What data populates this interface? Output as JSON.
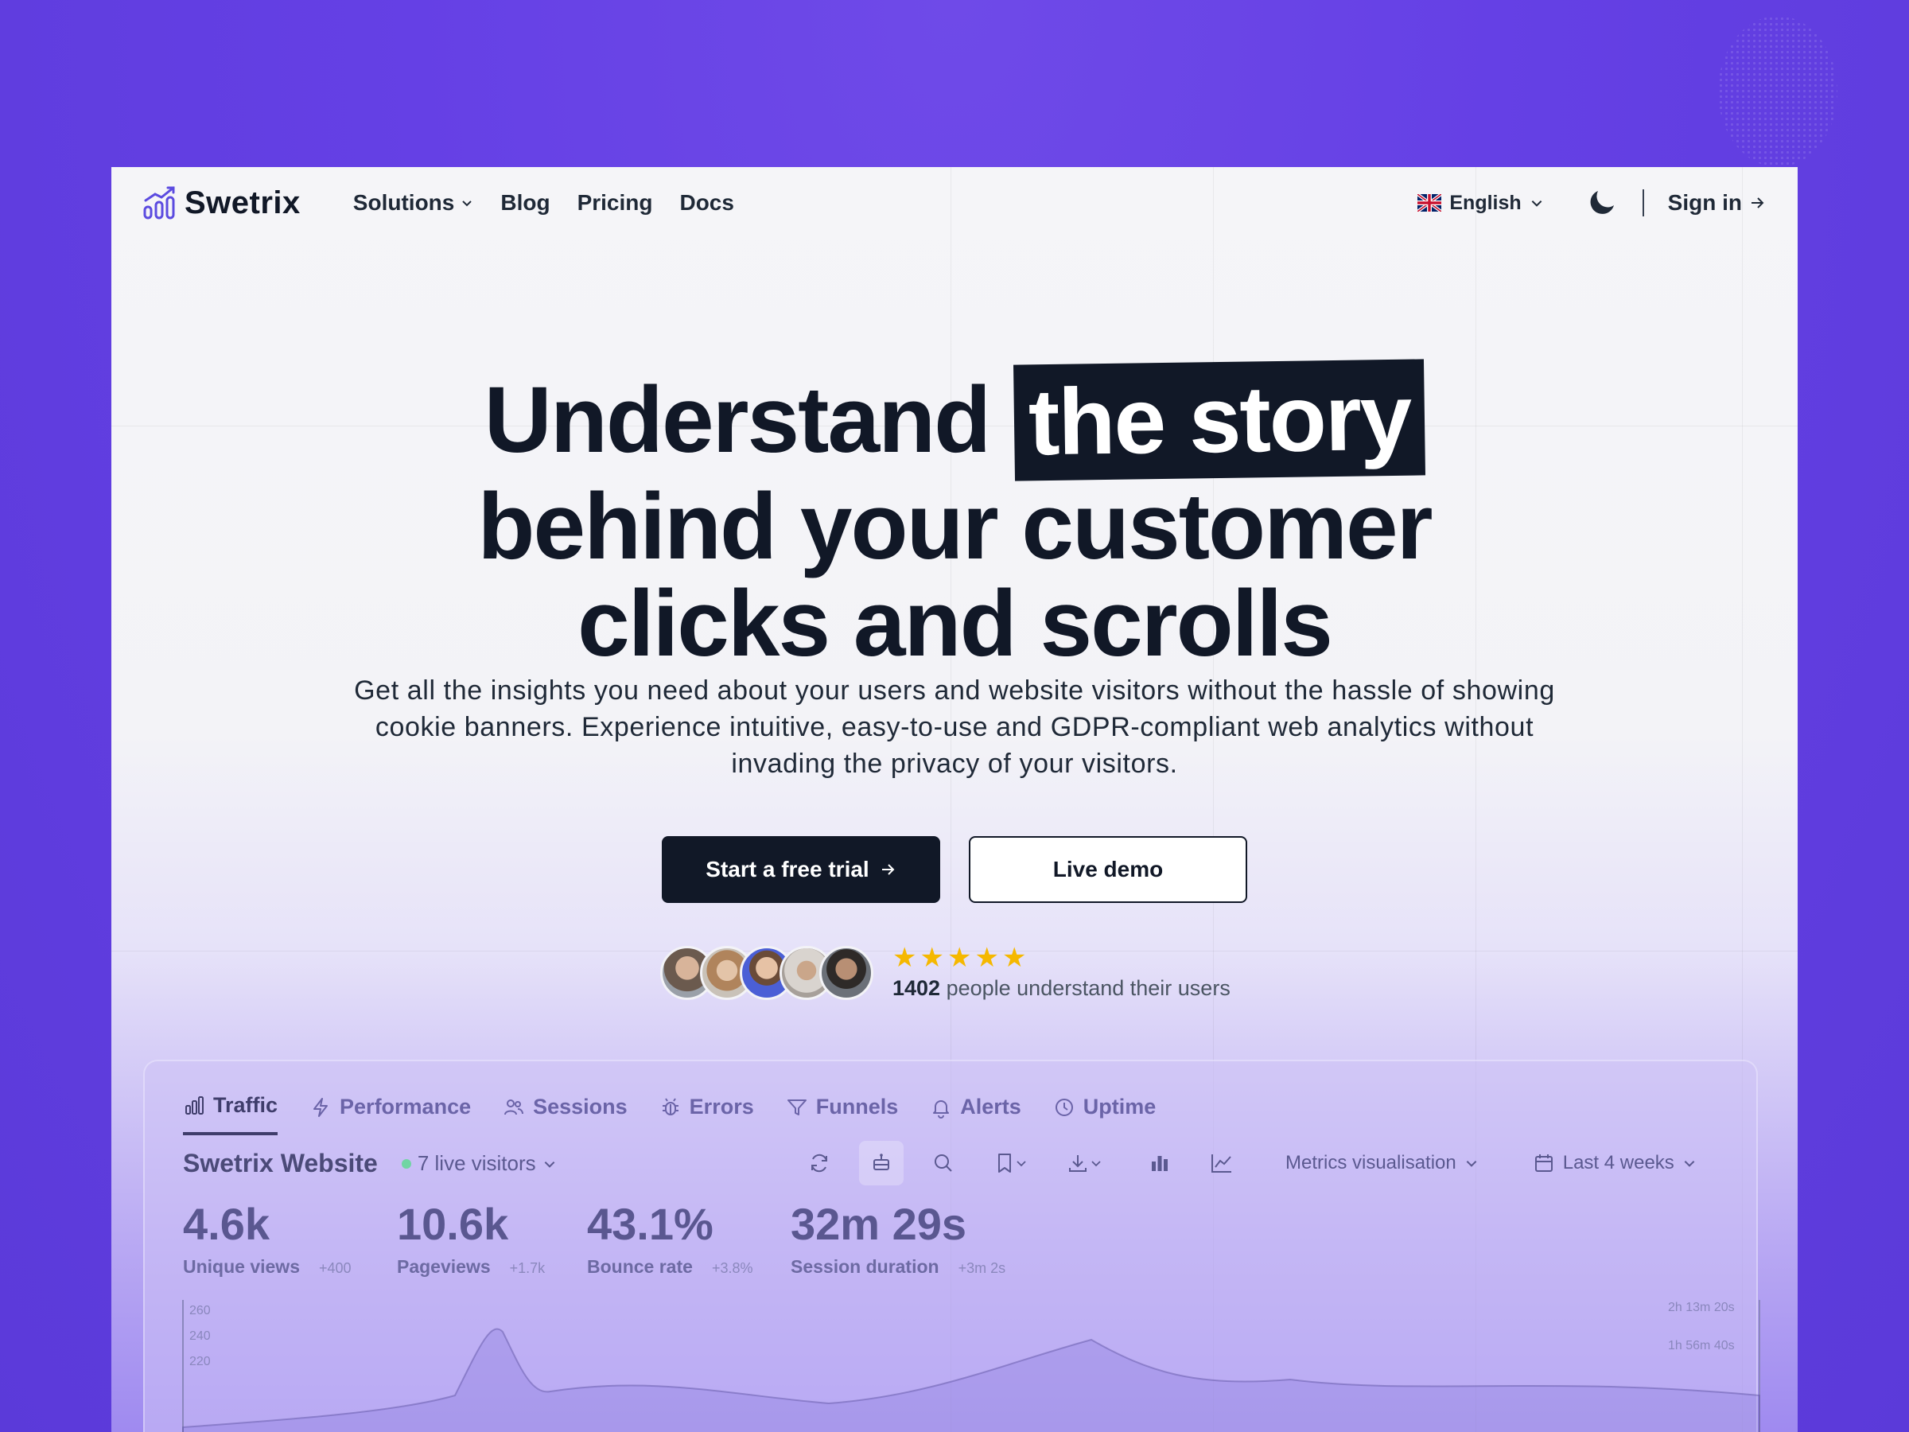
{
  "brand": {
    "name": "Swetrix"
  },
  "nav": {
    "menu": [
      {
        "label": "Solutions",
        "has_dropdown": true
      },
      {
        "label": "Blog",
        "has_dropdown": false
      },
      {
        "label": "Pricing",
        "has_dropdown": false
      },
      {
        "label": "Docs",
        "has_dropdown": false
      }
    ],
    "language": "English",
    "signin": "Sign in"
  },
  "hero": {
    "title_part1": "Understand",
    "title_highlight": "the story",
    "title_line2": "behind your customer",
    "title_line3": "clicks and scrolls",
    "subtitle": "Get all the insights you need about your users and website visitors without the hassle of showing cookie banners. Experience intuitive, easy-to-use and GDPR-compliant web analytics without invading the privacy of your visitors.",
    "cta_primary": "Start a free trial",
    "cta_secondary": "Live demo",
    "social_count": "1402",
    "social_text": " people understand their users",
    "stars": 5
  },
  "dashboard": {
    "tabs": [
      {
        "label": "Traffic",
        "icon": "bar-chart-icon",
        "active": true
      },
      {
        "label": "Performance",
        "icon": "lightning-icon",
        "active": false
      },
      {
        "label": "Sessions",
        "icon": "users-icon",
        "active": false
      },
      {
        "label": "Errors",
        "icon": "bug-icon",
        "active": false
      },
      {
        "label": "Funnels",
        "icon": "filter-icon",
        "active": false
      },
      {
        "label": "Alerts",
        "icon": "bell-icon",
        "active": false
      },
      {
        "label": "Uptime",
        "icon": "clock-icon",
        "active": false
      }
    ],
    "site_name": "Swetrix Website",
    "live_visitors": "7 live visitors",
    "metrics_visualisation": "Metrics visualisation",
    "period": "Last 4 weeks",
    "metrics": [
      {
        "value": "4.6k",
        "label": "Unique views",
        "delta": "+400"
      },
      {
        "value": "10.6k",
        "label": "Pageviews",
        "delta": "+1.7k"
      },
      {
        "value": "43.1%",
        "label": "Bounce rate",
        "delta": "+3.8%"
      },
      {
        "value": "32m 29s",
        "label": "Session duration",
        "delta": "+3m 2s"
      }
    ],
    "chart_axis": {
      "left_ticks": [
        "260",
        "240",
        "220"
      ],
      "right_ticks": [
        "2h 13m 20s",
        "1h 56m 40s"
      ]
    }
  },
  "colors": {
    "background": "#6540e5",
    "text_dark": "#111827",
    "star": "#f5b800",
    "accent": "#4f46e5"
  }
}
